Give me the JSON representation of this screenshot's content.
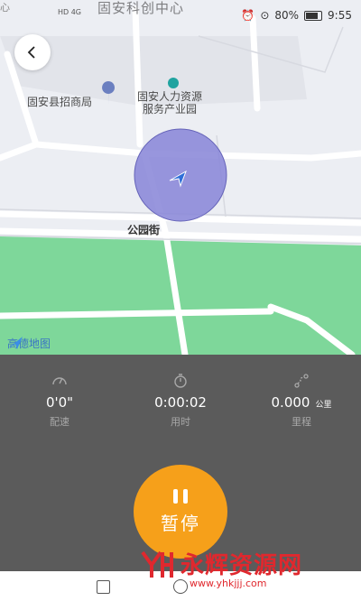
{
  "status_bar": {
    "title": "固安科创中心",
    "left_fragment": "心",
    "signal": "HD 4G",
    "battery": "80%",
    "time": "9:55"
  },
  "map": {
    "pois": [
      {
        "label": "固安县招商局"
      },
      {
        "label_line1": "固安人力资源",
        "label_line2": "服务产业园"
      }
    ],
    "street": "公园街",
    "provider": "高德地图"
  },
  "stats": [
    {
      "icon": "speedometer-icon",
      "value": "0'0\"",
      "unit": "",
      "label": "配速"
    },
    {
      "icon": "stopwatch-icon",
      "value": "0:00:02",
      "unit": "",
      "label": "用时"
    },
    {
      "icon": "route-icon",
      "value": "0.000",
      "unit": "公里",
      "label": "里程"
    }
  ],
  "pause_button": {
    "label": "暂停"
  },
  "watermark": {
    "text": "永辉资源网",
    "url": "www.yhkjjj.com"
  },
  "colors": {
    "accent": "#f6a01a",
    "panel": "#5b5b5b",
    "park": "#7ed79a",
    "location_circle": "#8a88d8"
  }
}
